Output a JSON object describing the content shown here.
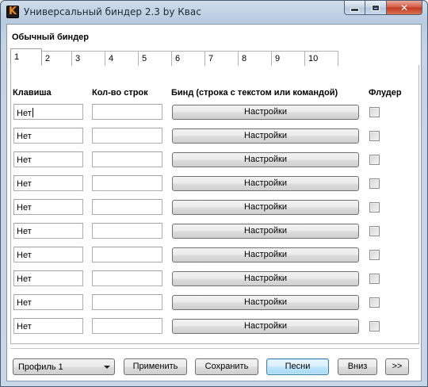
{
  "window": {
    "title": "Универсальный биндер 2.3 by Квас",
    "icon_letter": "K"
  },
  "group": {
    "title": "Обычный биндер"
  },
  "tabs": [
    "1",
    "2",
    "3",
    "4",
    "5",
    "6",
    "7",
    "8",
    "9",
    "10"
  ],
  "active_tab": "1",
  "columns": {
    "key": "Клавиша",
    "count": "Кол-во строк",
    "bind": "Бинд (строка с текстом или командой)",
    "flooder": "Флудер"
  },
  "rows": [
    {
      "key": "Нет",
      "count": "",
      "button": "Настройки",
      "flooder": false
    },
    {
      "key": "Нет",
      "count": "",
      "button": "Настройки",
      "flooder": false
    },
    {
      "key": "Нет",
      "count": "",
      "button": "Настройки",
      "flooder": false
    },
    {
      "key": "Нет",
      "count": "",
      "button": "Настройки",
      "flooder": false
    },
    {
      "key": "Нет",
      "count": "",
      "button": "Настройки",
      "flooder": false
    },
    {
      "key": "Нет",
      "count": "",
      "button": "Настройки",
      "flooder": false
    },
    {
      "key": "Нет",
      "count": "",
      "button": "Настройки",
      "flooder": false
    },
    {
      "key": "Нет",
      "count": "",
      "button": "Настройки",
      "flooder": false
    },
    {
      "key": "Нет",
      "count": "",
      "button": "Настройки",
      "flooder": false
    },
    {
      "key": "Нет",
      "count": "",
      "button": "Настройки",
      "flooder": false
    }
  ],
  "bottom": {
    "profile": "Профиль 1",
    "apply": "Применить",
    "save": "Сохранить",
    "songs": "Песни",
    "down": "Вниз",
    "next": ">>"
  },
  "colors": {
    "accent": "#3c7fb1",
    "icon_orange": "#f08a10",
    "close_red": "#c23a20"
  }
}
